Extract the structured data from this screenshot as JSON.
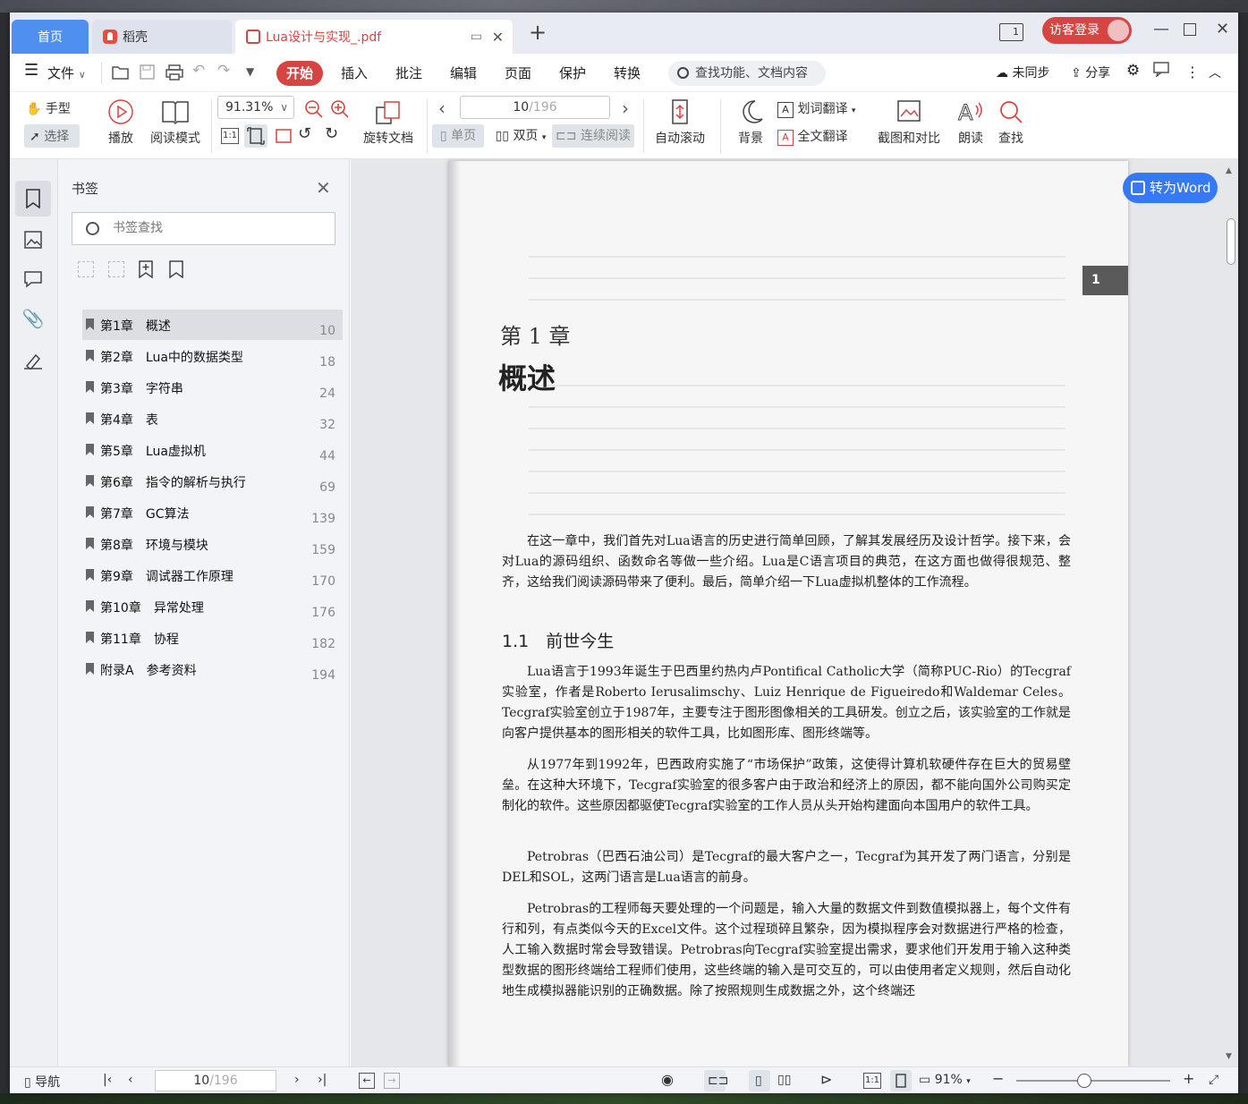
{
  "tabs": {
    "home": "首页",
    "daoke": "稻壳",
    "doc": "Lua设计与实现_.pdf"
  },
  "window": {
    "page_indicator": "1",
    "visitor_login": "访客登录"
  },
  "menu": {
    "file": "文件",
    "items": [
      "开始",
      "插入",
      "批注",
      "编辑",
      "页面",
      "保护",
      "转换"
    ],
    "search_placeholder": "查找功能、文档内容",
    "sync": "未同步",
    "share": "分享"
  },
  "toolbar": {
    "hand": "手型",
    "select": "选择",
    "play": "播放",
    "read_mode": "阅读模式",
    "zoom": "91.31%",
    "rotate": "旋转文档",
    "page_current": "10",
    "page_total": "/196",
    "single": "单页",
    "double": "双页",
    "continuous": "连续阅读",
    "autoscroll": "自动滚动",
    "background": "背景",
    "word_translate": "划词翻译",
    "full_translate": "全文翻译",
    "screenshot_compare": "截图和对比",
    "read_aloud": "朗读",
    "find": "查找",
    "actual_size": "1:1"
  },
  "sidebar": {
    "title": "书签",
    "search_placeholder": "书签查找",
    "bookmarks": [
      {
        "label": "第1章　概述",
        "page": "10"
      },
      {
        "label": "第2章　Lua中的数据类型",
        "page": "18"
      },
      {
        "label": "第3章　字符串",
        "page": "24"
      },
      {
        "label": "第4章　表",
        "page": "32"
      },
      {
        "label": "第5章　Lua虚拟机",
        "page": "44"
      },
      {
        "label": "第6章　指令的解析与执行",
        "page": "69"
      },
      {
        "label": "第7章　GC算法",
        "page": "139"
      },
      {
        "label": "第8章　环境与模块",
        "page": "159"
      },
      {
        "label": "第9章　调试器工作原理",
        "page": "170"
      },
      {
        "label": "第10章　异常处理",
        "page": "176"
      },
      {
        "label": "第11章　协程",
        "page": "182"
      },
      {
        "label": "附录A　参考资料",
        "page": "194"
      }
    ]
  },
  "document": {
    "chapter_no": "第 1 章",
    "chapter_title": "概述",
    "tab_marker": "1",
    "intro": "在这一章中，我们首先对Lua语言的历史进行简单回顾，了解其发展经历及设计哲学。接下来，会对Lua的源码组织、函数命名等做一些介绍。Lua是C语言项目的典范，在这方面也做得很规范、整齐，这给我们阅读源码带来了便利。最后，简单介绍一下Lua虚拟机整体的工作流程。",
    "section": "1.1　前世今生",
    "p1": "Lua语言于1993年诞生于巴西里约热内卢Pontifical Catholic大学（简称PUC-Rio）的Tecgraf实验室，作者是Roberto Ierusalimschy、Luiz Henrique de Figueiredo和Waldemar Celes。Tecgraf实验室创立于1987年，主要专注于图形图像相关的工具研发。创立之后，该实验室的工作就是向客户提供基本的图形相关的软件工具，比如图形库、图形终端等。",
    "p2": "从1977年到1992年，巴西政府实施了“市场保护”政策，这使得计算机软硬件存在巨大的贸易壁垒。在这种大环境下，Tecgraf实验室的很多客户由于政治和经济上的原因，都不能向国外公司购买定制化的软件。这些原因都驱使Tecgraf实验室的工作人员从头开始构建面向本国用户的软件工具。",
    "p3": "Petrobras（巴西石油公司）是Tecgraf的最大客户之一，Tecgraf为其开发了两门语言，分别是DEL和SOL，这两门语言是Lua语言的前身。",
    "p4": "Petrobras的工程师每天要处理的一个问题是，输入大量的数据文件到数值模拟器上，每个文件有行和列，有点类似今天的Excel文件。这个过程琐碎且繁杂，因为模拟程序会对数据进行严格的检查，人工输入数据时常会导致错误。Petrobras向Tecgraf实验室提出需求，要求他们开发用于输入这种类型数据的图形终端给工程师们使用，这些终端的输入是可交互的，可以由使用者定义规则，然后自动化地生成模拟器能识别的正确数据。除了按照规则生成数据之外，这个终端还"
  },
  "floating": {
    "to_word": "转为Word"
  },
  "statusbar": {
    "nav": "导航",
    "page_current": "10",
    "page_total": "/196",
    "zoom": "91%",
    "actual_size": "1:1"
  }
}
